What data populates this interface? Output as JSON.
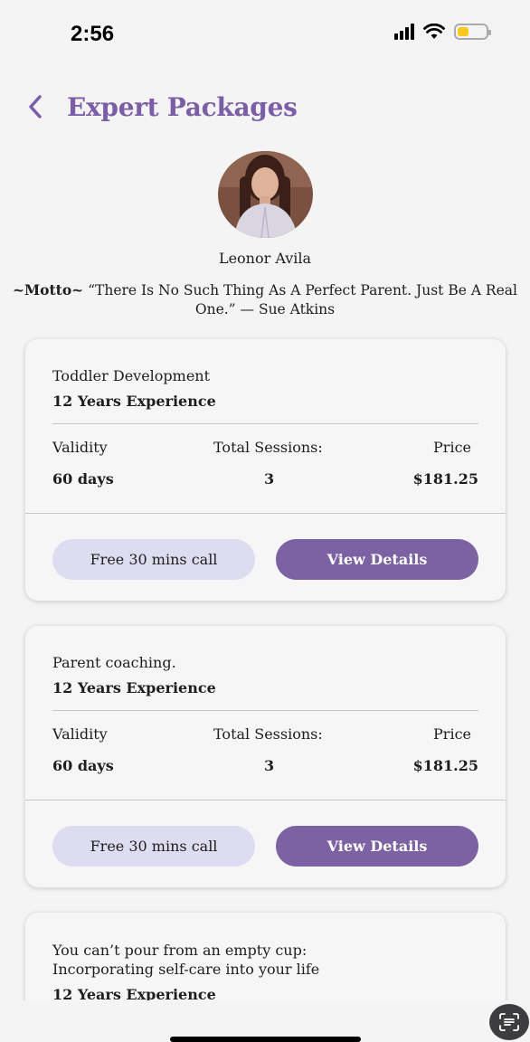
{
  "status": {
    "time": "2:56"
  },
  "header": {
    "title": "Expert Packages"
  },
  "expert": {
    "name": "Leonor Avila",
    "motto_label": "~Motto~",
    "motto_text": " “There Is No Such Thing As A Perfect Parent. Just Be A Real One.” — Sue Atkins"
  },
  "packages": [
    {
      "title": "Toddler Development",
      "experience": "12 Years Experience",
      "validity_label": "Validity",
      "validity": "60 days",
      "sessions_label": "Total Sessions:",
      "sessions": "3",
      "price_label": "Price",
      "price": "$181.25",
      "call_label": "Free 30 mins call",
      "details_label": "View Details"
    },
    {
      "title": "Parent coaching.",
      "experience": "12 Years Experience",
      "validity_label": "Validity",
      "validity": "60 days",
      "sessions_label": "Total Sessions:",
      "sessions": "3",
      "price_label": "Price",
      "price": "$181.25",
      "call_label": "Free 30 mins call",
      "details_label": "View Details"
    },
    {
      "title_line1": "You can’t pour from an empty cup:",
      "title_line2": "Incorporating self-care into your life",
      "experience": "12 Years Experience"
    }
  ],
  "colors": {
    "accent": "#7b5ea7",
    "button_light": "#dedcf1",
    "button_dark": "#7c62a3"
  },
  "icons": [
    "back-chevron-icon",
    "signal-icon",
    "wifi-icon",
    "battery-icon",
    "scan-text-icon"
  ]
}
